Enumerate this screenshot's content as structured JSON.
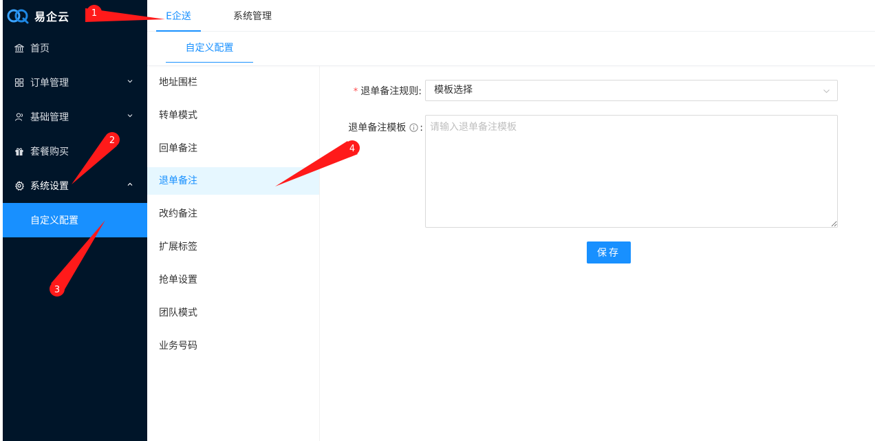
{
  "app": {
    "logo_text": "易企云"
  },
  "sidebar": {
    "items": [
      {
        "label": "首页",
        "icon": "bank-icon"
      },
      {
        "label": "订单管理",
        "icon": "grid-icon"
      },
      {
        "label": "基础管理",
        "icon": "users-icon"
      },
      {
        "label": "套餐购买",
        "icon": "gift-icon"
      },
      {
        "label": "系统设置",
        "icon": "gear-icon"
      }
    ],
    "sub_item": "自定义配置"
  },
  "top_tabs": [
    {
      "label": "E企送",
      "active": true
    },
    {
      "label": "系统管理",
      "active": false
    }
  ],
  "sub_tab": "自定义配置",
  "settings_menu": [
    "地址围栏",
    "转单模式",
    "回单备注",
    "退单备注",
    "改约备注",
    "扩展标签",
    "抢单设置",
    "团队模式",
    "业务号码"
  ],
  "settings_menu_active": "退单备注",
  "form": {
    "rule_label": "退单备注规则:",
    "rule_value": "模板选择",
    "template_label": "退单备注模板",
    "template_colon": ":",
    "template_placeholder": "请输入退单备注模板",
    "save_label": "保存"
  },
  "annotations": [
    "1",
    "2",
    "3",
    "4"
  ],
  "colors": {
    "sidebar_bg": "#001529",
    "accent": "#1890ff",
    "menu_active_bg": "#e6f7ff",
    "annotation_red": "#ff1a1a"
  }
}
